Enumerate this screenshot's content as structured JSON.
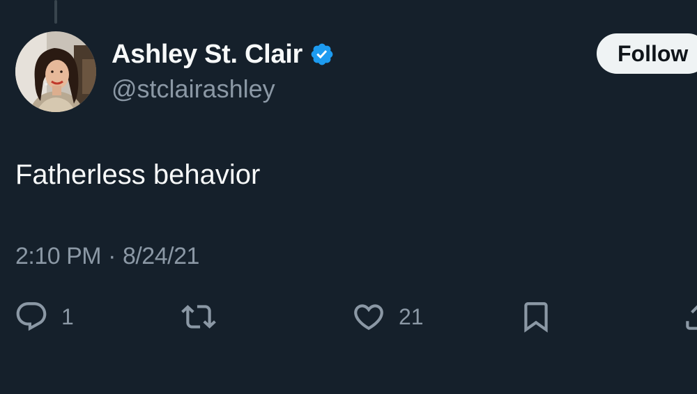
{
  "author": {
    "display_name": "Ashley St. Clair",
    "handle": "@stclairashley",
    "verified": true,
    "avatar_alt": "Profile photo"
  },
  "follow_label": "Follow",
  "tweet": {
    "text": "Fatherless behavior",
    "time": "2:10 PM",
    "separator": "·",
    "date": "8/24/21"
  },
  "actions": {
    "reply_count": "1",
    "retweet_count": "",
    "like_count": "21"
  },
  "colors": {
    "background": "#15202b",
    "primary_text": "#f7f9f9",
    "secondary_text": "#8b98a5",
    "verified_blue": "#1d9bf0",
    "follow_button_bg": "#eff3f4"
  }
}
